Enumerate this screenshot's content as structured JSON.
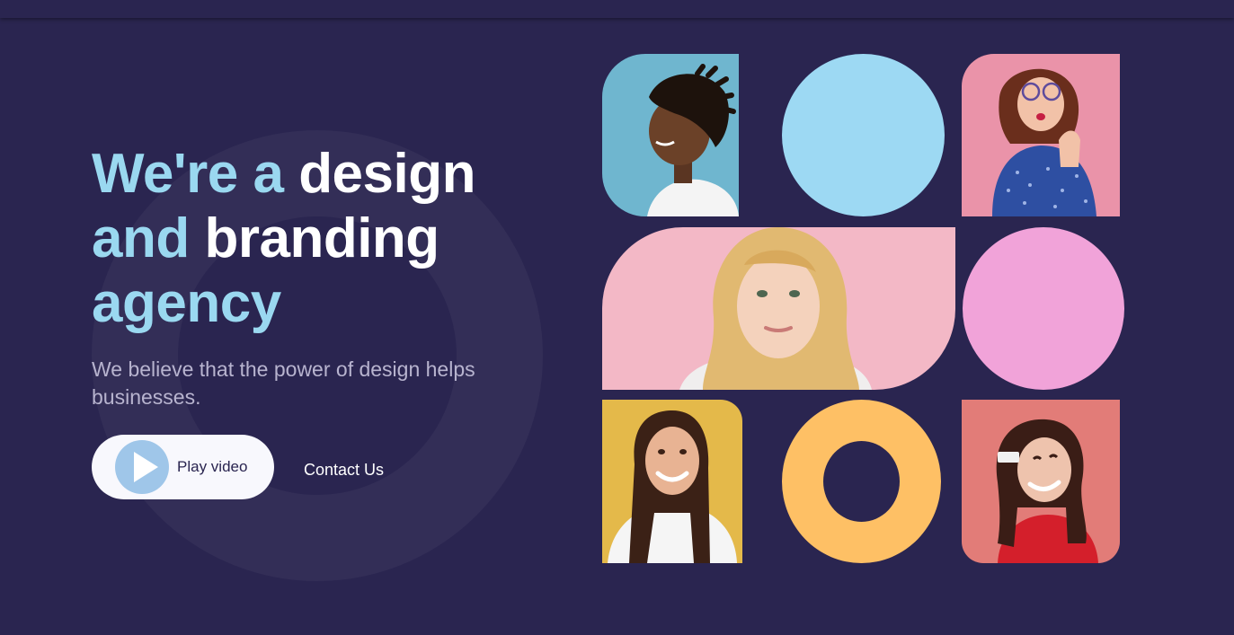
{
  "hero": {
    "title_line1_light": "We're a",
    "title_line1_white": "design",
    "title_line2_light": "and",
    "title_line2_white": "branding",
    "title_line3_light": "agency",
    "subtitle": "We believe that the power of design helps businesses."
  },
  "actions": {
    "play_label": "Play video",
    "contact_label": "Contact Us"
  },
  "colors": {
    "background": "#2a2550",
    "accent_light_blue": "#9ad8f0",
    "circle_blue": "#9dd9f3",
    "circle_pink": "#f1a3d9",
    "ring_orange": "#fec065",
    "play_icon": "#9fc6e9"
  },
  "gallery": {
    "tiles": [
      {
        "kind": "photo",
        "subject": "man in profile on light blue background"
      },
      {
        "kind": "shape",
        "shape": "circle",
        "color": "light blue"
      },
      {
        "kind": "photo",
        "subject": "woman with glasses on pink background"
      },
      {
        "kind": "photo",
        "subject": "blonde woman on pink background"
      },
      {
        "kind": "shape",
        "shape": "circle",
        "color": "pink"
      },
      {
        "kind": "photo",
        "subject": "smiling woman on yellow background"
      },
      {
        "kind": "shape",
        "shape": "ring",
        "color": "orange"
      },
      {
        "kind": "photo",
        "subject": "smiling woman in red on coral background"
      }
    ]
  }
}
